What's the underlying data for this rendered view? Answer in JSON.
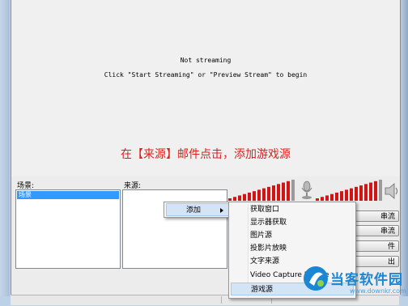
{
  "preview": {
    "status_line": "Not streaming",
    "hint_line": "Click \"Start Streaming\" or \"Preview Stream\" to begin"
  },
  "annotation": "在【来源】邮件点击，添加游戏源",
  "scenes": {
    "label": "场景:",
    "items": [
      "场景"
    ]
  },
  "sources": {
    "label": "来源:"
  },
  "buttons": {
    "b1": "串流",
    "b2": "串流",
    "b3": "件",
    "b4": "出"
  },
  "context_menu": {
    "add_label": "添加"
  },
  "submenu": {
    "items": [
      "获取窗口",
      "显示器获取",
      "图片源",
      "投影片放映",
      "文字来源",
      "Video Capture Device",
      "游戏源"
    ]
  },
  "watermark": {
    "text": "当客软件园",
    "url": "www.downkr.com"
  },
  "colors": {
    "annotation": "#e01e1e",
    "meter": "#d11515",
    "selection": "#3399ff"
  },
  "meters": {
    "left_level": 0.9,
    "right_level": 0.95
  }
}
